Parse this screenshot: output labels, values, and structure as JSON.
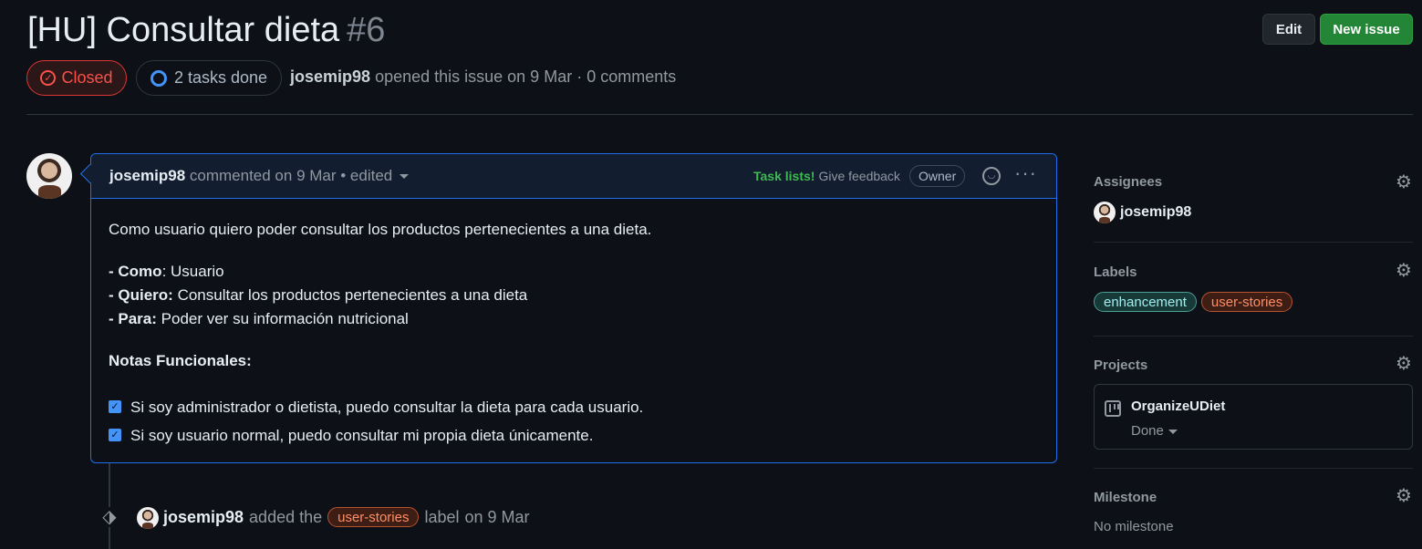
{
  "issue": {
    "title": "[HU] Consultar dieta",
    "number": "#6",
    "state": "Closed",
    "tasks_done": "2 tasks done",
    "author": "josemip98",
    "opened_text": "opened this issue on 9 Mar · 0 comments"
  },
  "header_buttons": {
    "edit": "Edit",
    "new_issue": "New issue"
  },
  "comment": {
    "author": "josemip98",
    "meta": "commented on 9 Mar • edited",
    "task_lists": "Task lists!",
    "give_feedback": "Give feedback",
    "owner_badge": "Owner",
    "more": "···",
    "intro": "Como usuario quiero poder consultar los productos pertenecientes a una dieta.",
    "como_label": "Como",
    "como_value": ": Usuario",
    "quiero_label": "Quiero:",
    "quiero_value": " Consultar los productos pertenecientes a una dieta",
    "para_label": "Para:",
    "para_value": " Poder ver su información nutricional",
    "notes_heading": "Notas Funcionales:",
    "tasks": [
      {
        "text": "Si soy administrador o dietista, puedo consultar la dieta para cada usuario.",
        "checked": true
      },
      {
        "text": "Si soy usuario normal, puedo consultar mi propia dieta únicamente.",
        "checked": true
      }
    ]
  },
  "timeline_event": {
    "actor": "josemip98",
    "pre": "added the",
    "label": "user-stories",
    "post": "label",
    "when": "on 9 Mar"
  },
  "sidebar": {
    "assignees_heading": "Assignees",
    "assignee": "josemip98",
    "labels_heading": "Labels",
    "labels": [
      "enhancement",
      "user-stories"
    ],
    "projects_heading": "Projects",
    "project_name": "OrganizeUDiet",
    "project_status": "Done",
    "milestone_heading": "Milestone",
    "milestone_value": "No milestone"
  },
  "colors": {
    "background": "#0d1117",
    "closed_red": "#f85149",
    "new_issue_green": "#238636",
    "accent_blue": "#1f6feb"
  },
  "icons": [
    "closed-issue-icon",
    "task-progress-icon",
    "smiley-icon",
    "kebab-icon",
    "tag-icon",
    "gear-icon",
    "project-board-icon",
    "caret-down-icon"
  ]
}
